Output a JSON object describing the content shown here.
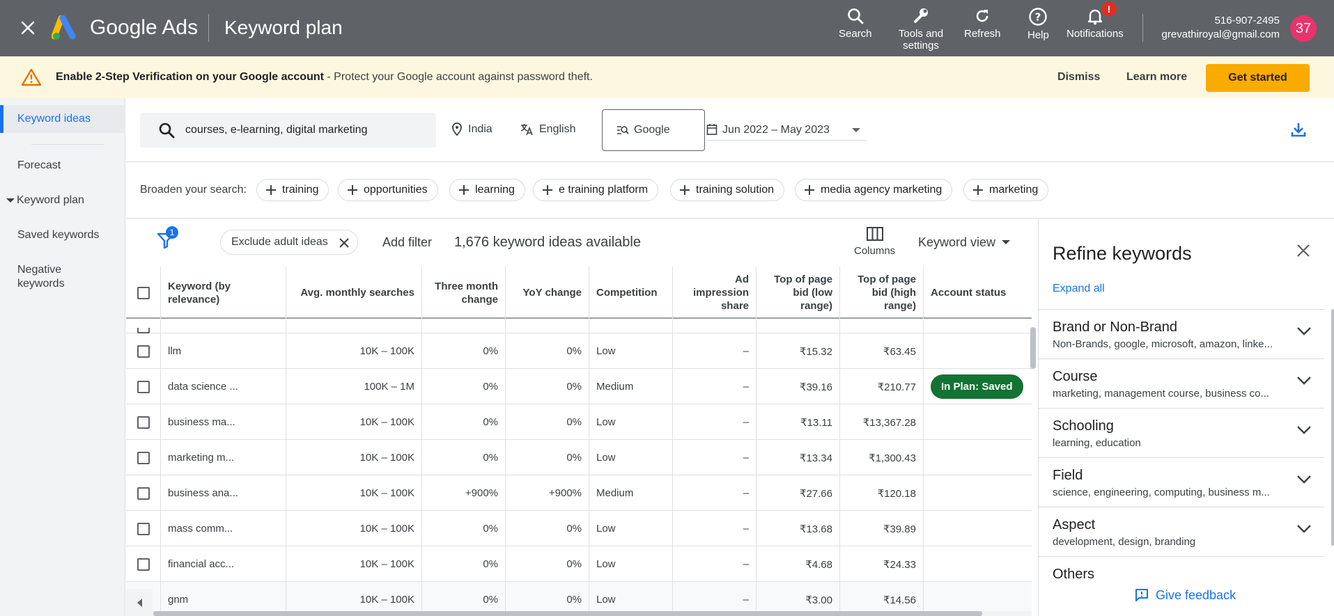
{
  "topbar": {
    "brand": "Google Ads",
    "page_title": "Keyword plan",
    "actions": {
      "search": "Search",
      "tools": "Tools and settings",
      "refresh": "Refresh",
      "help": "Help",
      "notifications": "Notifications"
    },
    "notification_badge": "!",
    "account_phone": "516-907-2495",
    "account_email": "grevathiroyal@gmail.com",
    "avatar": "37"
  },
  "banner": {
    "headline": "Enable 2-Step Verification on your Google account",
    "message": " - Protect your Google account against password theft.",
    "dismiss": "Dismiss",
    "learn_more": "Learn more",
    "cta": "Get started"
  },
  "nav": {
    "items": [
      {
        "label": "Keyword ideas"
      },
      {
        "label": "Forecast"
      },
      {
        "label": "Keyword plan"
      },
      {
        "label": "Saved keywords"
      },
      {
        "label": "Negative keywords"
      }
    ]
  },
  "search": {
    "query": "courses, e-learning, digital marketing",
    "location": "India",
    "language": "English",
    "network": "Google",
    "date_range": "Jun 2022 – May 2023"
  },
  "broaden": {
    "label": "Broaden your search:",
    "chips": [
      "training",
      "opportunities",
      "learning",
      "e training platform",
      "training solution",
      "media agency marketing",
      "marketing"
    ]
  },
  "filters": {
    "badge": "1",
    "exclude_chip": "Exclude adult ideas",
    "add_filter": "Add filter",
    "count_text": "1,676 keyword ideas available",
    "columns": "Columns",
    "view": "Keyword view"
  },
  "table": {
    "headers": {
      "keyword": "Keyword (by relevance)",
      "avg": "Avg. monthly searches",
      "three_month": "Three month change",
      "yoy": "YoY change",
      "competition": "Competition",
      "ad_impr": "Ad impression share",
      "low_bid": "Top of page bid (low range)",
      "high_bid": "Top of page bid (high range)",
      "status": "Account status"
    },
    "rows": [
      {
        "keyword": "llm",
        "avg": "10K – 100K",
        "three": "0%",
        "yoy": "0%",
        "comp": "Low",
        "impr": "–",
        "low": "₹15.32",
        "high": "₹63.45",
        "status": ""
      },
      {
        "keyword": "data science ...",
        "avg": "100K – 1M",
        "three": "0%",
        "yoy": "0%",
        "comp": "Medium",
        "impr": "–",
        "low": "₹39.16",
        "high": "₹210.77",
        "status": "In Plan: Saved"
      },
      {
        "keyword": "business ma...",
        "avg": "10K – 100K",
        "three": "0%",
        "yoy": "0%",
        "comp": "Low",
        "impr": "–",
        "low": "₹13.11",
        "high": "₹13,367.28",
        "status": ""
      },
      {
        "keyword": "marketing m...",
        "avg": "10K – 100K",
        "three": "0%",
        "yoy": "0%",
        "comp": "Low",
        "impr": "–",
        "low": "₹13.34",
        "high": "₹1,300.43",
        "status": ""
      },
      {
        "keyword": "business ana...",
        "avg": "10K – 100K",
        "three": "+900%",
        "yoy": "+900%",
        "comp": "Medium",
        "impr": "–",
        "low": "₹27.66",
        "high": "₹120.18",
        "status": ""
      },
      {
        "keyword": "mass comm...",
        "avg": "10K – 100K",
        "three": "0%",
        "yoy": "0%",
        "comp": "Low",
        "impr": "–",
        "low": "₹13.68",
        "high": "₹39.89",
        "status": ""
      },
      {
        "keyword": "financial acc...",
        "avg": "10K – 100K",
        "three": "0%",
        "yoy": "0%",
        "comp": "Low",
        "impr": "–",
        "low": "₹4.68",
        "high": "₹24.33",
        "status": ""
      },
      {
        "keyword": "gnm",
        "avg": "10K – 100K",
        "three": "0%",
        "yoy": "0%",
        "comp": "Low",
        "impr": "–",
        "low": "₹3.00",
        "high": "₹14.56",
        "status": ""
      }
    ]
  },
  "refine": {
    "title": "Refine keywords",
    "expand_all": "Expand all",
    "groups": [
      {
        "title": "Brand or Non-Brand",
        "subtitle": "Non-Brands, google, microsoft, amazon, linke..."
      },
      {
        "title": "Course",
        "subtitle": "marketing, management course, business co..."
      },
      {
        "title": "Schooling",
        "subtitle": "learning, education"
      },
      {
        "title": "Field",
        "subtitle": "science, engineering, computing, business m..."
      },
      {
        "title": "Aspect",
        "subtitle": "development, design, branding"
      },
      {
        "title": "Others",
        "subtitle": ""
      }
    ],
    "feedback": "Give feedback"
  },
  "colors": {
    "topbar": "#5f6368",
    "banner": "#fef7e0",
    "accent": "#1a73e8",
    "cta": "#f9ab00",
    "saved_pill": "#137333",
    "avatar": "#e8336d"
  }
}
